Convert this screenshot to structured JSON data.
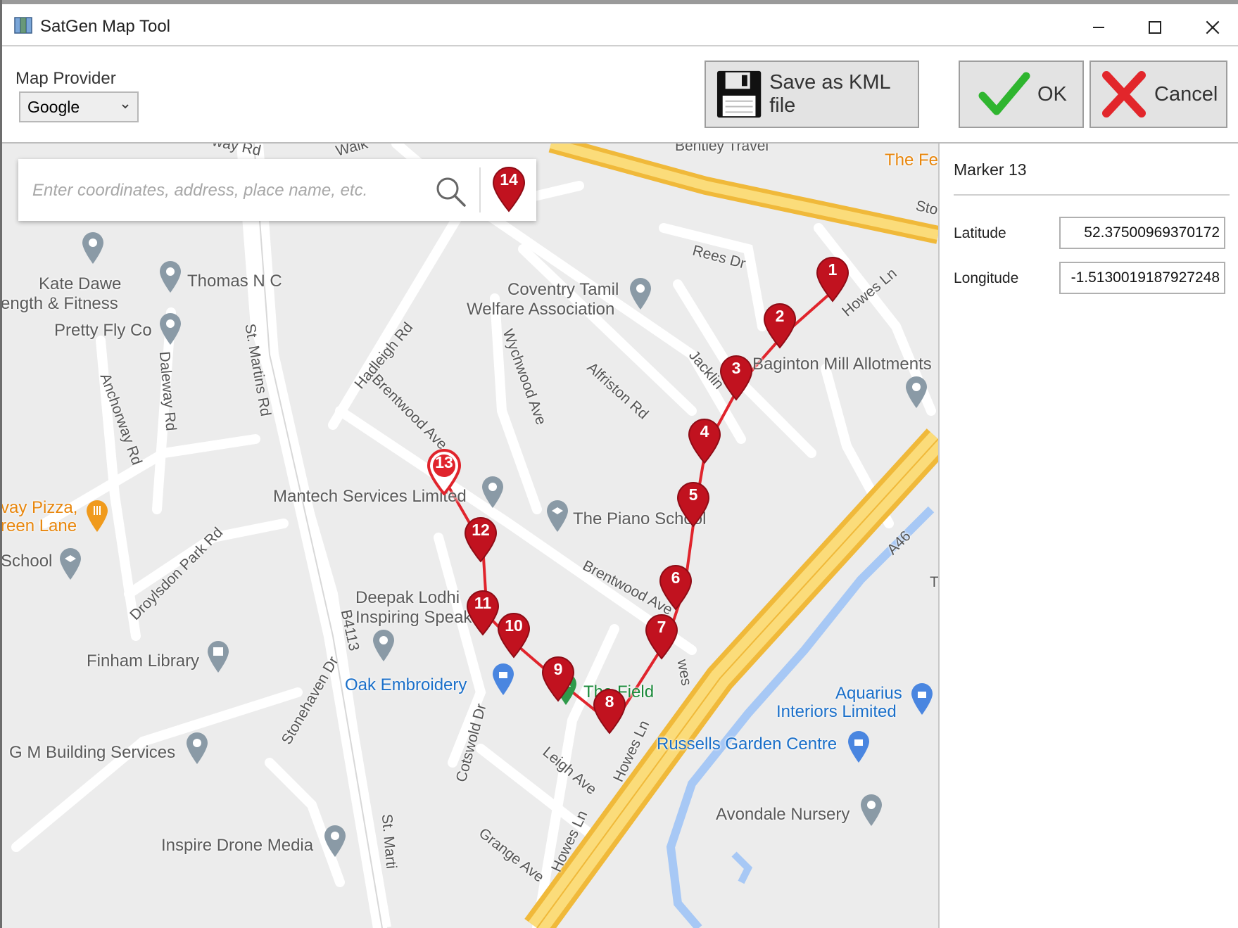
{
  "window": {
    "title": "SatGen Map Tool",
    "minimize_label": "—",
    "maximize_label": "☐",
    "close_label": "✕"
  },
  "toolbar": {
    "provider_label": "Map Provider",
    "provider_value": "Google",
    "save_label": "Save as KML file",
    "ok_label": "OK",
    "cancel_label": "Cancel"
  },
  "search": {
    "placeholder": "Enter coordinates, address, place name, etc.",
    "pin_number": "14"
  },
  "map": {
    "labels": {
      "kate": "Kate Dawe",
      "fitness": "ength & Fitness",
      "thomas": "Thomas N C",
      "prettyfly": "Pretty Fly Co",
      "tamil1": "Coventry Tamil",
      "tamil2": "Welfare Association",
      "mantech": "Mantech Services Limited",
      "piano": "The Piano School",
      "pizza1": "vay Pizza,",
      "pizza2": "reen Lane",
      "school": "School",
      "deepak1": "Deepak Lodhi",
      "deepak2": "Inspiring Speaker",
      "finham": "Finham Library",
      "oak": "Oak Embroidery",
      "field": "The Field",
      "aquarius1": "Aquarius",
      "aquarius2": "Interiors Limited",
      "russells": "Russells Garden Centre",
      "gm": "G M Building Services",
      "avondale": "Avondale Nursery",
      "inspire": "Inspire Drone Media",
      "allotments": "Baginton Mill Allotments",
      "bentley": "Bentley Travel",
      "thefe": "The Fe",
      "reesdr": "Rees Dr",
      "howesln": "Howes Ln",
      "jackling": "Jacklin",
      "alfriston": "Alfriston Rd",
      "wychwood": "Wychwood Ave",
      "hadleigh": "Hadleigh Rd",
      "brentwood1": "Brentwood Ave",
      "brentwood2": "Brentwood Ave",
      "stmartins": "St. Martins Rd",
      "stmartins2": "St. Marti",
      "daleway": "Daleway Rd",
      "anchorway": "Anchorway Rd",
      "droylsdon": "Droylsdon Park Rd",
      "b4113": "B4113",
      "stonehaven": "Stonehaven Dr",
      "cotswold": "Cotswold Dr",
      "grange": "Grange Ave",
      "howesln2": "Howes Ln",
      "howesln3": "Howes Ln",
      "a46": "A46",
      "wayrd": "way Rd",
      "walk": "Walk",
      "sto": "Sto",
      "t": "T",
      "leigh": "Leigh Ave",
      "wes": "wes"
    },
    "markers": [
      "1",
      "2",
      "3",
      "4",
      "5",
      "6",
      "7",
      "8",
      "9",
      "10",
      "11",
      "12",
      "13"
    ],
    "colors": {
      "marker": "#c1121f",
      "route": "#e0242c",
      "highway": "#f4c44a",
      "water": "#a7c8f5"
    }
  },
  "details": {
    "title": "Marker 13",
    "latitude_label": "Latitude",
    "latitude_value": "52.37500969370172",
    "longitude_label": "Longitude",
    "longitude_value": "-1.5130019187927248"
  }
}
